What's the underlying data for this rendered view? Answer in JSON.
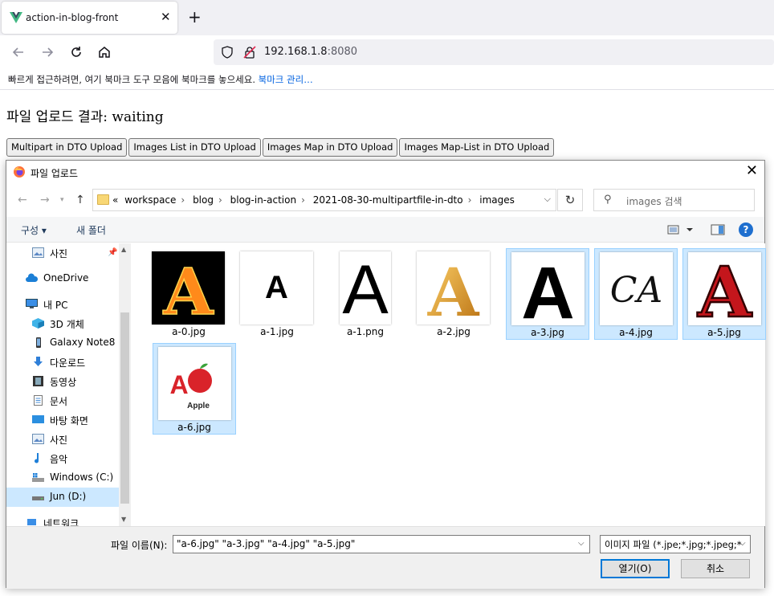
{
  "browser": {
    "tab_title": "action-in-blog-front",
    "url_host": "192.168.1.8",
    "url_port": ":8080",
    "bookmarks_message": "빠르게 접근하려면, 여기 북마크 도구 모음에 북마크를 놓으세요.",
    "bookmarks_link": "북마크 관리…"
  },
  "page": {
    "result_label": "파일 업로드 결과: waiting",
    "buttons": [
      "Multipart in DTO Upload",
      "Images List in DTO Upload",
      "Images Map in DTO Upload",
      "Images Map-List in DTO Upload"
    ]
  },
  "dialog": {
    "title": "파일 업로드",
    "breadcrumb_prefix": "«",
    "breadcrumbs": [
      "workspace",
      "blog",
      "blog-in-action",
      "2021-08-30-multipartfile-in-dto",
      "images"
    ],
    "search_placeholder": "images 검색",
    "toolbar": {
      "organize": "구성 ▾",
      "new_folder": "새 폴더"
    },
    "nav_items": [
      "사진",
      "OneDrive",
      "내 PC",
      "3D 개체",
      "Galaxy Note8",
      "다운로드",
      "동영상",
      "문서",
      "바탕 화면",
      "사진",
      "음악",
      "Windows (C:)",
      "Jun (D:)",
      "네트워크"
    ],
    "files": [
      {
        "name": "a-0.jpg",
        "selected": false
      },
      {
        "name": "a-1.jpg",
        "selected": false
      },
      {
        "name": "a-1.png",
        "selected": false
      },
      {
        "name": "a-2.jpg",
        "selected": false
      },
      {
        "name": "a-3.jpg",
        "selected": true
      },
      {
        "name": "a-4.jpg",
        "selected": true
      },
      {
        "name": "a-5.jpg",
        "selected": true
      },
      {
        "name": "a-6.jpg",
        "selected": true
      }
    ],
    "thumb_text": {
      "letter": "A",
      "script_letter": "CA",
      "apple_word": "Apple"
    },
    "file_name_label": "파일 이름(N):",
    "file_name_value": "\"a-6.jpg\" \"a-3.jpg\" \"a-4.jpg\" \"a-5.jpg\"",
    "file_type": "이미지 파일 (*.jpe;*.jpg;*.jpeg;*",
    "open_label": "열기(O)",
    "cancel_label": "취소"
  }
}
